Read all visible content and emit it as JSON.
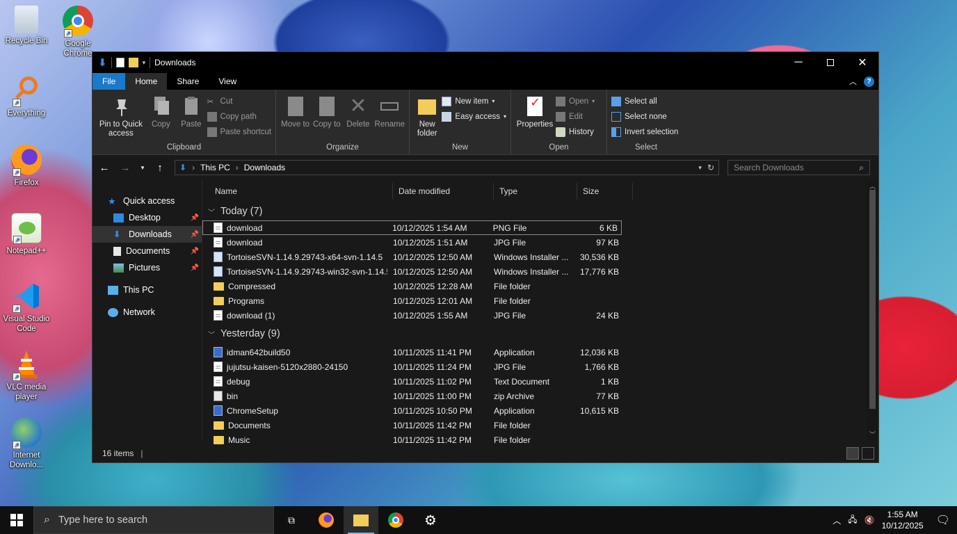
{
  "desktop": {
    "icons": [
      {
        "label": "Recycle Bin"
      },
      {
        "label": "Google Chrome"
      },
      {
        "label": "Everything"
      },
      {
        "label": "Firefox"
      },
      {
        "label": "Notepad++"
      },
      {
        "label": "Visual Studio Code"
      },
      {
        "label": "VLC media player"
      },
      {
        "label": "Internet Downlo..."
      }
    ]
  },
  "window": {
    "title": "Downloads",
    "tabs": {
      "file": "File",
      "home": "Home",
      "share": "Share",
      "view": "View"
    },
    "ribbon": {
      "clipboard": {
        "label": "Clipboard",
        "pin": "Pin to Quick access",
        "copy": "Copy",
        "paste": "Paste",
        "cut": "Cut",
        "copy_path": "Copy path",
        "paste_shortcut": "Paste shortcut"
      },
      "organize": {
        "label": "Organize",
        "move_to": "Move to",
        "copy_to": "Copy to",
        "delete": "Delete",
        "rename": "Rename"
      },
      "new": {
        "label": "New",
        "new_folder": "New folder",
        "new_item": "New item",
        "easy_access": "Easy access"
      },
      "open": {
        "label": "Open",
        "properties": "Properties",
        "open": "Open",
        "edit": "Edit",
        "history": "History"
      },
      "select": {
        "label": "Select",
        "select_all": "Select all",
        "select_none": "Select none",
        "invert": "Invert selection"
      }
    },
    "address": {
      "crumbs": [
        "This PC",
        "Downloads"
      ],
      "search_placeholder": "Search Downloads"
    },
    "nav": {
      "quick_access": "Quick access",
      "desktop": "Desktop",
      "downloads": "Downloads",
      "documents": "Documents",
      "pictures": "Pictures",
      "this_pc": "This PC",
      "network": "Network"
    },
    "columns": {
      "name": "Name",
      "date": "Date modified",
      "type": "Type",
      "size": "Size"
    },
    "groups": {
      "today": {
        "label": "Today (7)",
        "rows": [
          {
            "name": "download",
            "date": "10/12/2025 1:54 AM",
            "type": "PNG File",
            "size": "6 KB"
          },
          {
            "name": "download",
            "date": "10/12/2025 1:51 AM",
            "type": "JPG File",
            "size": "97 KB"
          },
          {
            "name": "TortoiseSVN-1.14.9.29743-x64-svn-1.14.5",
            "date": "10/12/2025 12:50 AM",
            "type": "Windows Installer ...",
            "size": "30,536 KB"
          },
          {
            "name": "TortoiseSVN-1.14.9.29743-win32-svn-1.14.5",
            "date": "10/12/2025 12:50 AM",
            "type": "Windows Installer ...",
            "size": "17,776 KB"
          },
          {
            "name": "Compressed",
            "date": "10/12/2025 12:28 AM",
            "type": "File folder",
            "size": ""
          },
          {
            "name": "Programs",
            "date": "10/12/2025 12:01 AM",
            "type": "File folder",
            "size": ""
          },
          {
            "name": "download (1)",
            "date": "10/12/2025 1:55 AM",
            "type": "JPG File",
            "size": "24 KB"
          }
        ]
      },
      "yesterday": {
        "label": "Yesterday (9)",
        "rows": [
          {
            "name": "idman642build50",
            "date": "10/11/2025 11:41 PM",
            "type": "Application",
            "size": "12,036 KB"
          },
          {
            "name": "jujutsu-kaisen-5120x2880-24150",
            "date": "10/11/2025 11:24 PM",
            "type": "JPG File",
            "size": "1,766 KB"
          },
          {
            "name": "debug",
            "date": "10/11/2025 11:02 PM",
            "type": "Text Document",
            "size": "1 KB"
          },
          {
            "name": "bin",
            "date": "10/11/2025 11:00 PM",
            "type": "zip Archive",
            "size": "77 KB"
          },
          {
            "name": "ChromeSetup",
            "date": "10/11/2025 10:50 PM",
            "type": "Application",
            "size": "10,615 KB"
          },
          {
            "name": "Documents",
            "date": "10/11/2025 11:42 PM",
            "type": "File folder",
            "size": ""
          },
          {
            "name": "Music",
            "date": "10/11/2025 11:42 PM",
            "type": "File folder",
            "size": ""
          }
        ]
      }
    },
    "status": {
      "items": "16 items"
    }
  },
  "taskbar": {
    "search_placeholder": "Type here to search",
    "time": "1:55 AM",
    "date": "10/12/2025"
  }
}
